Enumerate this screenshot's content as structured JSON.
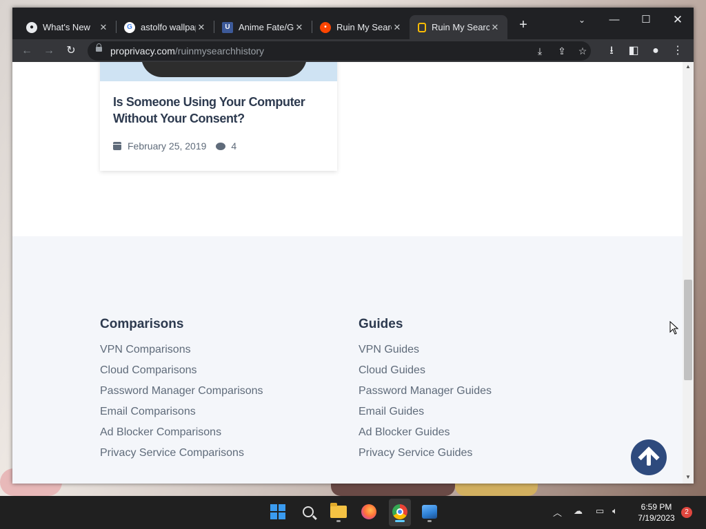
{
  "browser": {
    "tabs": [
      {
        "label": "What's New",
        "icon": "chrome-icon",
        "active": false
      },
      {
        "label": "astolfo wallpap",
        "icon": "google-icon",
        "active": false
      },
      {
        "label": "Anime Fate/Gr",
        "icon": "site-icon",
        "active": false
      },
      {
        "label": "Ruin My Searc",
        "icon": "reddit-icon",
        "active": false
      },
      {
        "label": "Ruin My Searc",
        "icon": "proprivacy-icon",
        "active": true
      }
    ],
    "url_host": "proprivacy.com",
    "url_path": "/ruinmysearchhistory"
  },
  "page": {
    "card": {
      "title": "Is Someone Using Your Computer Without Your Consent?",
      "date": "February 25, 2019",
      "comments": "4"
    },
    "footer": {
      "comparisons": {
        "heading": "Comparisons",
        "links": [
          "VPN Comparisons",
          "Cloud Comparisons",
          "Password Manager Comparisons",
          "Email Comparisons",
          "Ad Blocker Comparisons",
          "Privacy Service Comparisons"
        ]
      },
      "guides": {
        "heading": "Guides",
        "links": [
          "VPN Guides",
          "Cloud Guides",
          "Password Manager Guides",
          "Email Guides",
          "Ad Blocker Guides",
          "Privacy Service Guides"
        ]
      }
    }
  },
  "taskbar": {
    "time": "6:59 PM",
    "date": "7/19/2023",
    "notifications": "2"
  },
  "colors": {
    "accent": "#2e4a7d",
    "heading": "#2d3a4f",
    "link": "#5f6b7a",
    "footer_bg": "#f4f6fa"
  }
}
